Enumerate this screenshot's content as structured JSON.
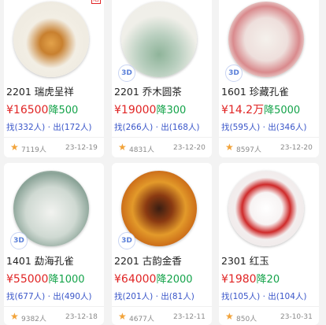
{
  "colors": {
    "price": "#e02424",
    "drop": "#14a34a",
    "stats": "#3a56c9",
    "star": "#f2a33a"
  },
  "cards": [
    {
      "name": "2201 瑞虎呈祥",
      "price": "¥16500",
      "drop": "降500",
      "stats": "找(332人) · 出(172人)",
      "views": "7119人",
      "date": "23-12-19",
      "has3d": false
    },
    {
      "name": "2201 乔木圆茶",
      "price": "¥19000",
      "drop": "降300",
      "stats": "找(266人) · 出(168人)",
      "views": "4831人",
      "date": "23-12-20",
      "has3d": true
    },
    {
      "name": "1601 珍藏孔雀",
      "price": "¥14.2万",
      "drop": "降5000",
      "stats": "找(595人) · 出(346人)",
      "views": "8597人",
      "date": "23-12-20",
      "has3d": true
    },
    {
      "name": "1401 勐海孔雀",
      "price": "¥55000",
      "drop": "降1000",
      "stats": "找(677人) · 出(490人)",
      "views": "9382人",
      "date": "23-12-18",
      "has3d": true
    },
    {
      "name": "2201 古韵金香",
      "price": "¥64000",
      "drop": "降2000",
      "stats": "找(201人) · 出(81人)",
      "views": "4677人",
      "date": "23-12-11",
      "has3d": true
    },
    {
      "name": "2301 红玉",
      "price": "¥1980",
      "drop": "降20",
      "stats": "找(105人) · 出(104人)",
      "views": "850人",
      "date": "23-10-31",
      "has3d": false
    }
  ],
  "badge_3d": "3D",
  "hot_label": "活"
}
